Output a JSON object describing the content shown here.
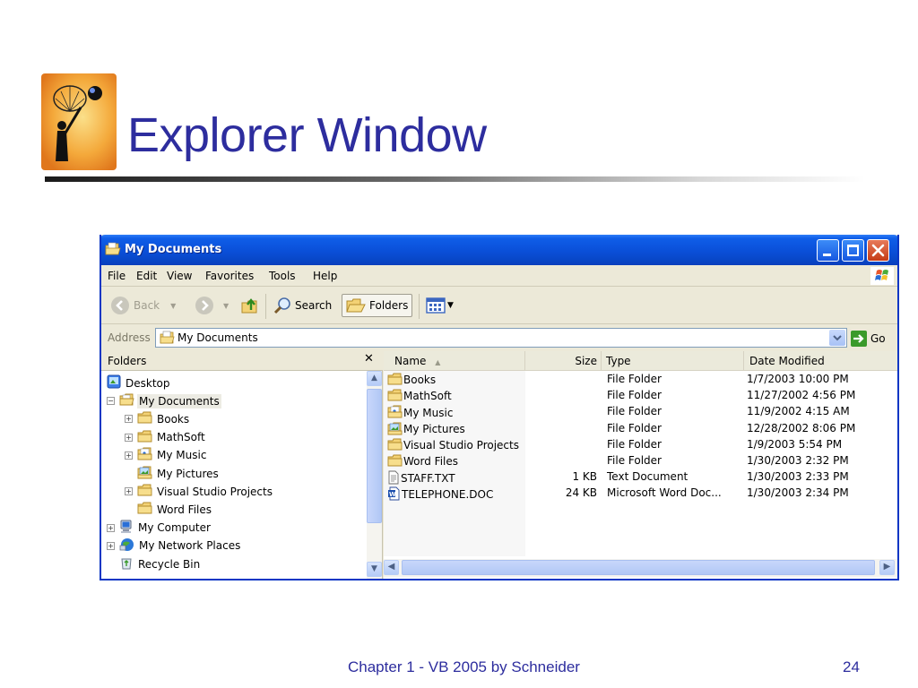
{
  "slide": {
    "title": "Explorer Window",
    "footer": "Chapter 1 - VB 2005 by Schneider",
    "page_number": "24"
  },
  "window": {
    "title": "My Documents",
    "menu": [
      "File",
      "Edit",
      "View",
      "Favorites",
      "Tools",
      "Help"
    ],
    "toolbar": {
      "back_label": "Back",
      "search_label": "Search",
      "folders_label": "Folders"
    },
    "address": {
      "label": "Address",
      "value": "My Documents",
      "go_label": "Go"
    }
  },
  "folders_pane": {
    "header": "Folders",
    "close_glyph": "✕",
    "tree": [
      {
        "label": "Desktop",
        "icon": "desktop-icon",
        "level": 0,
        "expander": "",
        "selected": false
      },
      {
        "label": "My Documents",
        "icon": "open-folder-icon",
        "level": 0,
        "expander": "−",
        "selected": true
      },
      {
        "label": "Books",
        "icon": "folder-icon",
        "level": 1,
        "expander": "+",
        "selected": false
      },
      {
        "label": "MathSoft",
        "icon": "folder-icon",
        "level": 1,
        "expander": "+",
        "selected": false
      },
      {
        "label": "My Music",
        "icon": "music-folder-icon",
        "level": 1,
        "expander": "+",
        "selected": false
      },
      {
        "label": "My Pictures",
        "icon": "pictures-folder-icon",
        "level": 1,
        "expander": "",
        "selected": false
      },
      {
        "label": "Visual Studio Projects",
        "icon": "folder-icon",
        "level": 1,
        "expander": "+",
        "selected": false
      },
      {
        "label": "Word Files",
        "icon": "folder-icon",
        "level": 1,
        "expander": "",
        "selected": false
      },
      {
        "label": "My Computer",
        "icon": "computer-icon",
        "level": 0,
        "expander": "+",
        "selected": false
      },
      {
        "label": "My Network Places",
        "icon": "network-icon",
        "level": 0,
        "expander": "+",
        "selected": false
      },
      {
        "label": "Recycle Bin",
        "icon": "recycle-bin-icon",
        "level": 0,
        "expander": "",
        "selected": false
      }
    ]
  },
  "file_list": {
    "columns": [
      "Name",
      "Size",
      "Type",
      "Date Modified"
    ],
    "sort_indicator": "▲",
    "rows": [
      {
        "name": "Books",
        "size": "",
        "type": "File Folder",
        "date": "1/7/2003 10:00 PM",
        "icon": "folder-icon"
      },
      {
        "name": "MathSoft",
        "size": "",
        "type": "File Folder",
        "date": "11/27/2002 4:56 PM",
        "icon": "folder-icon"
      },
      {
        "name": "My Music",
        "size": "",
        "type": "File Folder",
        "date": "11/9/2002 4:15 AM",
        "icon": "music-folder-icon"
      },
      {
        "name": "My Pictures",
        "size": "",
        "type": "File Folder",
        "date": "12/28/2002 8:06 PM",
        "icon": "pictures-folder-icon"
      },
      {
        "name": "Visual Studio Projects",
        "size": "",
        "type": "File Folder",
        "date": "1/9/2003 5:54 PM",
        "icon": "folder-icon"
      },
      {
        "name": "Word Files",
        "size": "",
        "type": "File Folder",
        "date": "1/30/2003 2:32 PM",
        "icon": "folder-icon"
      },
      {
        "name": "STAFF.TXT",
        "size": "1 KB",
        "type": "Text Document",
        "date": "1/30/2003 2:33 PM",
        "icon": "text-file-icon"
      },
      {
        "name": "TELEPHONE.DOC",
        "size": "24 KB",
        "type": "Microsoft Word Doc...",
        "date": "1/30/2003 2:34 PM",
        "icon": "word-doc-icon"
      }
    ]
  },
  "colors": {
    "title_text": "#2d2d9e",
    "titlebar": "#0a4fd8",
    "window_face": "#ece9d8",
    "folder": "#f3d275",
    "close_button": "#c53b16"
  }
}
